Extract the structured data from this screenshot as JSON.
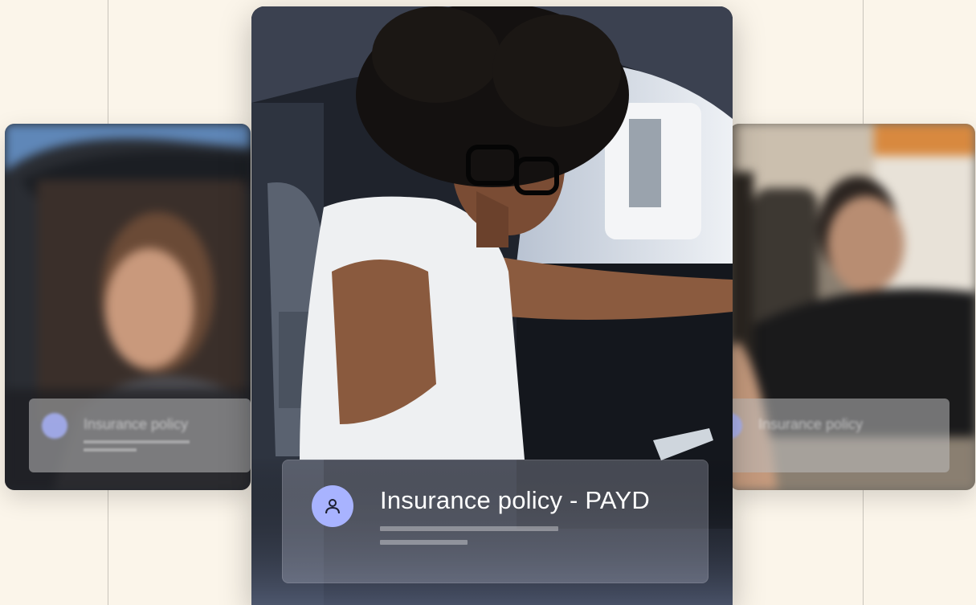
{
  "main_card": {
    "title": "Insurance policy - PAYD",
    "avatar_icon": "user-icon"
  },
  "left_card": {
    "title": "Insurance policy"
  },
  "right_card": {
    "title": "Insurance policy"
  },
  "colors": {
    "background": "#fbf5ea",
    "accent": "#a8b3ff",
    "guide_line": "#c9c4bb"
  }
}
